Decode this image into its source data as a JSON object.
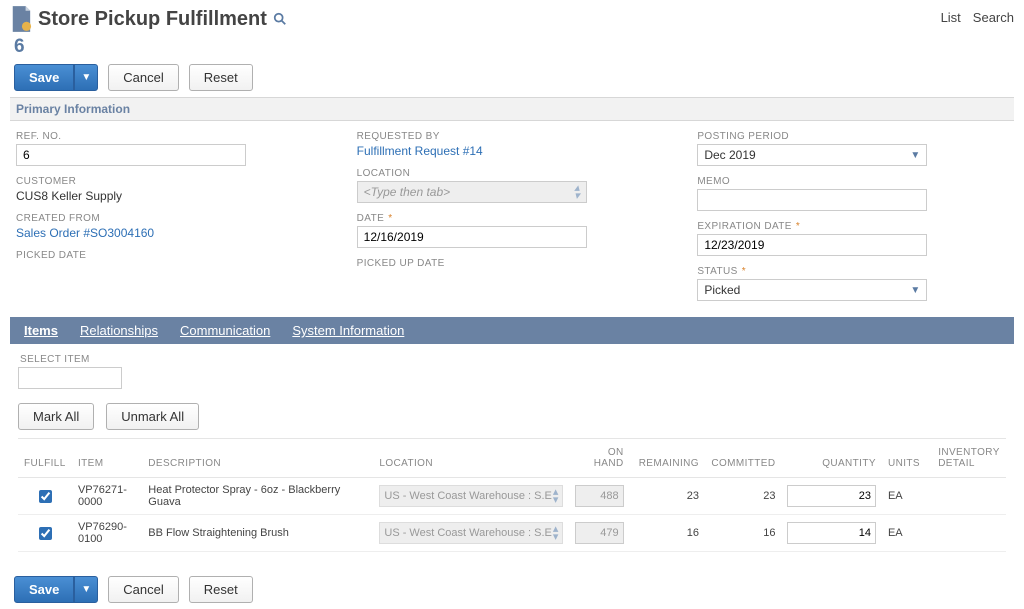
{
  "header": {
    "title": "Store Pickup Fulfillment",
    "links": {
      "list": "List",
      "search": "Search"
    }
  },
  "record": {
    "id": "6"
  },
  "buttons": {
    "save": "Save",
    "cancel": "Cancel",
    "reset": "Reset",
    "markAll": "Mark All",
    "unmarkAll": "Unmark All"
  },
  "section": {
    "primary": "Primary Information"
  },
  "fields": {
    "refNo": {
      "label": "REF. NO.",
      "value": "6"
    },
    "customer": {
      "label": "CUSTOMER",
      "value": "CUS8 Keller Supply"
    },
    "createdFrom": {
      "label": "CREATED FROM",
      "value": "Sales Order #SO3004160"
    },
    "pickedDate": {
      "label": "PICKED DATE",
      "value": ""
    },
    "requestedBy": {
      "label": "REQUESTED BY",
      "value": "Fulfillment Request #14"
    },
    "location": {
      "label": "LOCATION",
      "placeholder": "<Type then tab>"
    },
    "date": {
      "label": "DATE",
      "value": "12/16/2019"
    },
    "pickedUpDate": {
      "label": "PICKED UP DATE",
      "value": ""
    },
    "postingPeriod": {
      "label": "POSTING PERIOD",
      "value": "Dec 2019"
    },
    "memo": {
      "label": "MEMO",
      "value": ""
    },
    "expirationDate": {
      "label": "EXPIRATION DATE",
      "value": "12/23/2019"
    },
    "status": {
      "label": "STATUS",
      "value": "Picked"
    }
  },
  "tabs": {
    "items": "Items",
    "relationships": "Relationships",
    "communication": "Communication",
    "systemInfo": "System Information"
  },
  "itemsSection": {
    "selectItem": "SELECT ITEM",
    "columns": {
      "fulfill": "FULFILL",
      "item": "ITEM",
      "description": "DESCRIPTION",
      "location": "LOCATION",
      "onHand": "ON HAND",
      "remaining": "REMAINING",
      "committed": "COMMITTED",
      "quantity": "QUANTITY",
      "units": "UNITS",
      "inventoryDetail": "INVENTORY DETAIL"
    },
    "rows": [
      {
        "fulfill": true,
        "item": "VP76271-0000",
        "description": "Heat Protector Spray - 6oz - Blackberry Guava",
        "location": "US - West Coast Warehouse : S.E",
        "onHand": "488",
        "remaining": "23",
        "committed": "23",
        "quantity": "23",
        "units": "EA"
      },
      {
        "fulfill": true,
        "item": "VP76290-0100",
        "description": "BB Flow Straightening Brush",
        "location": "US - West Coast Warehouse : S.E",
        "onHand": "479",
        "remaining": "16",
        "committed": "16",
        "quantity": "14",
        "units": "EA"
      }
    ]
  }
}
